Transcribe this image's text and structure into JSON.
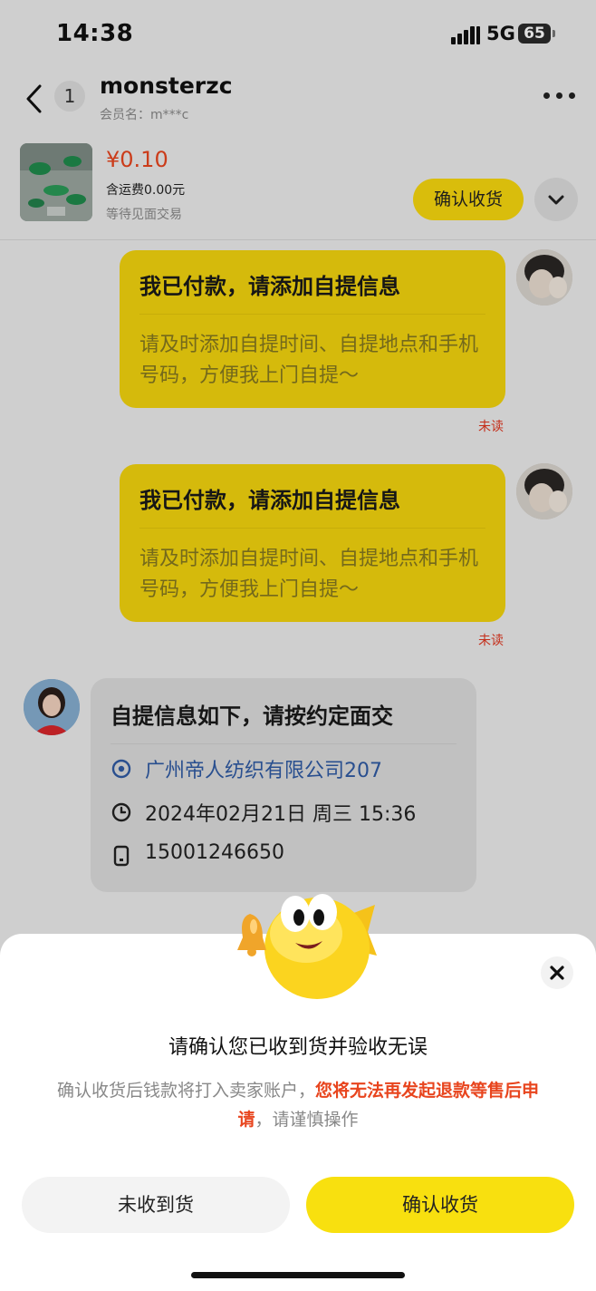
{
  "status_bar": {
    "time": "14:38",
    "network": "5G",
    "battery": "65"
  },
  "header": {
    "back_icon": "chevron-left-icon",
    "unread_count": "1",
    "contact_name": "monsterzc",
    "member_id": "会员名：m***c",
    "more_icon": "more-dots-icon"
  },
  "order": {
    "price": "¥0.10",
    "shipping": "含运费0.00元",
    "status": "等待见面交易",
    "confirm_label": "确认收货",
    "expand_icon": "chevron-down-icon"
  },
  "messages": [
    {
      "title": "我已付款，请添加自提信息",
      "body": "请及时添加自提时间、自提地点和手机号码，方便我上门自提～",
      "read_status": "未读"
    },
    {
      "title": "我已付款，请添加自提信息",
      "body": "请及时添加自提时间、自提地点和手机号码，方便我上门自提～",
      "read_status": "未读"
    }
  ],
  "pickup_info": {
    "title": "自提信息如下，请按约定面交",
    "location": "广州帝人纺织有限公司207",
    "datetime": "2024年02月21日 周三 15:36",
    "phone": "15001246650",
    "location_icon": "location-pin-icon",
    "time_icon": "clock-icon",
    "phone_icon": "phone-icon"
  },
  "dialog": {
    "title": "请确认您已收到货并验收无误",
    "desc_prefix": "确认收货后钱款将打入卖家账户，",
    "desc_warning": "您将无法再发起退款等售后申请",
    "desc_suffix": "，请谨慎操作",
    "cancel_label": "未收到货",
    "confirm_label": "确认收货",
    "close_icon": "close-icon",
    "colors": {
      "primary": "#f8e00f",
      "warning": "#e8451e"
    }
  }
}
